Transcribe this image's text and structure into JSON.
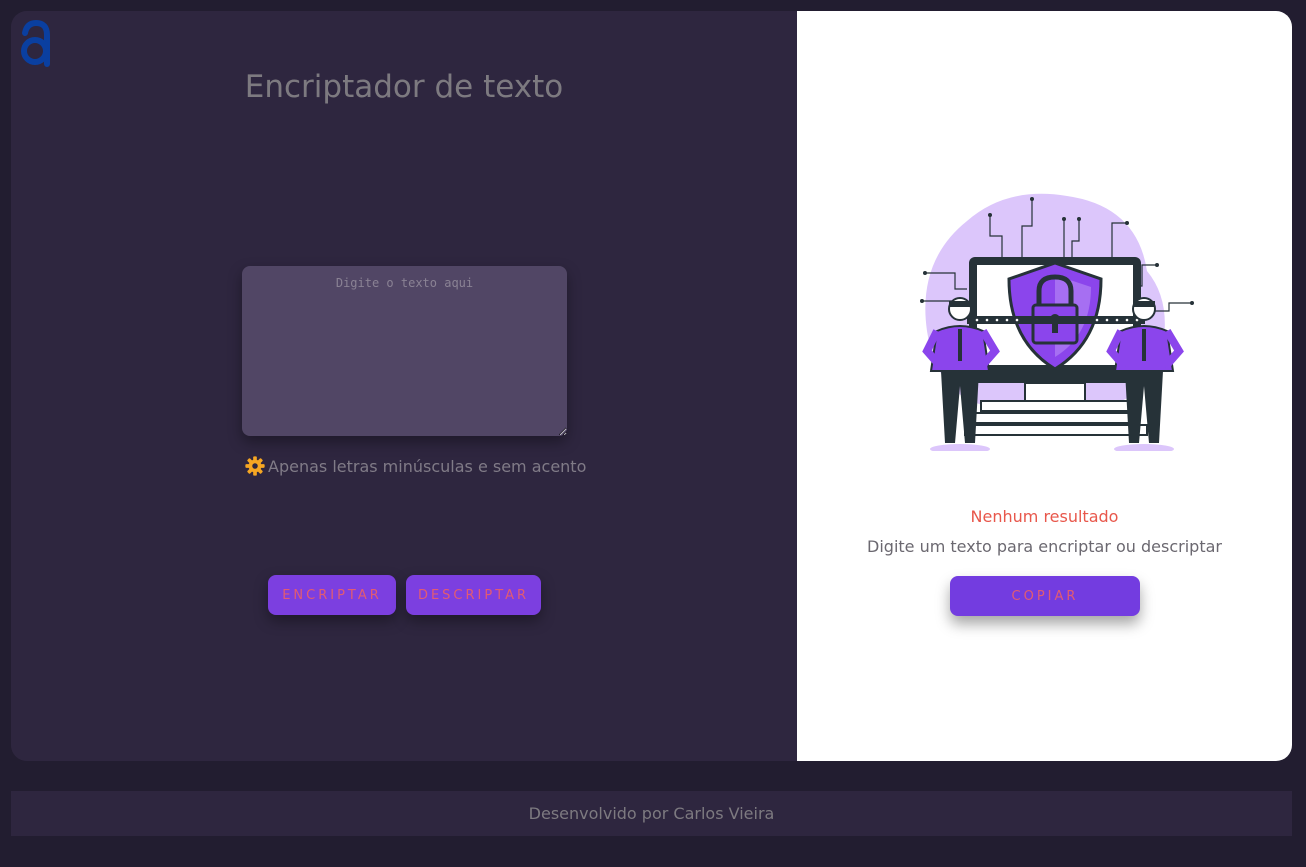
{
  "logo": {
    "icon": "a-logo-icon",
    "color": "#0a3fa0"
  },
  "encrypter": {
    "title": "Encriptador de texto",
    "input_placeholder": "Digite o texto aqui",
    "input_value": "",
    "hint_icon": "gear-icon",
    "hint_text": "Apenas letras minúsculas e sem acento",
    "encrypt_label": "ENCRIPTAR",
    "decrypt_label": "DESCRIPTAR"
  },
  "output": {
    "illustration": "security-lock-illustration",
    "empty_title": "Nenhum resultado",
    "empty_description": "Digite um texto para encriptar ou descriptar",
    "copy_label": "COPIAR"
  },
  "footer": {
    "text": "Desenvolvido por Carlos Vieira"
  },
  "colors": {
    "background": "#221d30",
    "panel": "#2e263f",
    "accent": "#7c3fe0",
    "button_text": "#e25b72",
    "error": "#e8574b",
    "illustration_purple": "#8b45ec"
  }
}
